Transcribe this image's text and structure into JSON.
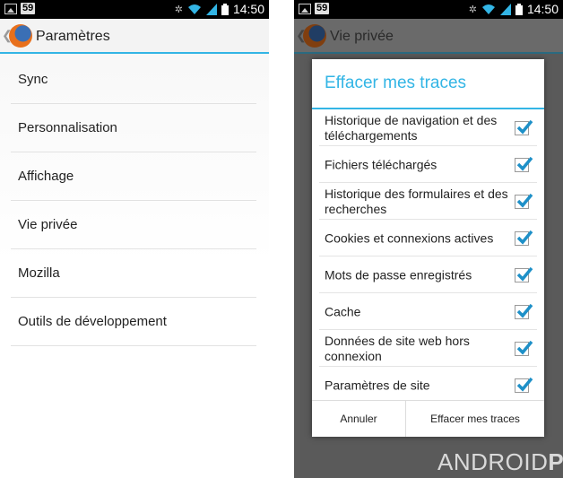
{
  "status_bar": {
    "notification_count": "59",
    "time": "14:50"
  },
  "left_screen": {
    "title": "Paramètres",
    "menu": [
      {
        "label": "Sync"
      },
      {
        "label": "Personnalisation"
      },
      {
        "label": "Affichage"
      },
      {
        "label": "Vie privée"
      },
      {
        "label": "Mozilla"
      },
      {
        "label": "Outils de développement"
      }
    ]
  },
  "right_screen": {
    "title": "Vie privée",
    "dialog": {
      "title": "Effacer mes traces",
      "options": [
        {
          "label": "Historique de navigation et des téléchargements",
          "checked": true
        },
        {
          "label": "Fichiers téléchargés",
          "checked": true
        },
        {
          "label": "Historique des formulaires et des recherches",
          "checked": true
        },
        {
          "label": "Cookies et connexions actives",
          "checked": true
        },
        {
          "label": "Mots de passe enregistrés",
          "checked": true
        },
        {
          "label": "Cache",
          "checked": true
        },
        {
          "label": "Données de site web hors connexion",
          "checked": true
        },
        {
          "label": "Paramètres de site",
          "checked": true
        }
      ],
      "cancel_label": "Annuler",
      "confirm_label": "Effacer mes traces"
    }
  },
  "watermark": {
    "part1": "ANDROID",
    "part2": "PIT"
  },
  "colors": {
    "accent": "#33b5e5",
    "check": "#1e90c8"
  },
  "icons": [
    "image-icon",
    "wifi-icon",
    "signal-icon",
    "battery-icon",
    "firefox-logo-icon",
    "checkbox-icon"
  ]
}
